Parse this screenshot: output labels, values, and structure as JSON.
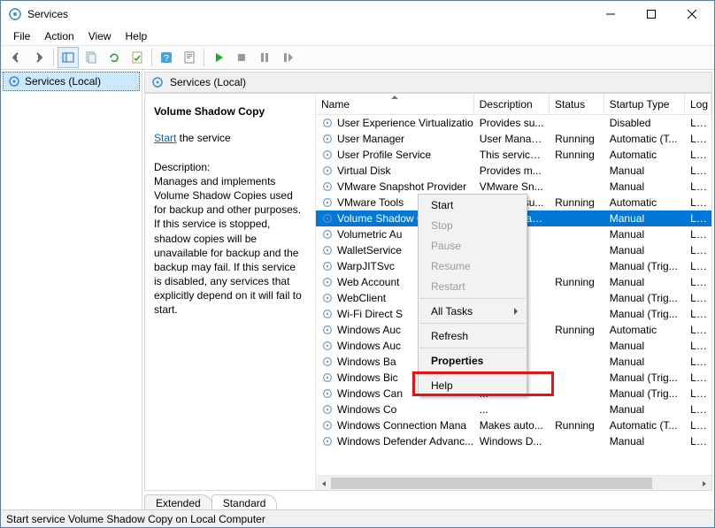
{
  "window": {
    "title": "Services"
  },
  "menu": [
    "File",
    "Action",
    "View",
    "Help"
  ],
  "left": {
    "node": "Services (Local)"
  },
  "pane_header": "Services (Local)",
  "detail": {
    "title": "Volume Shadow Copy",
    "start": "Start",
    "after": " the service",
    "desc_label": "Description:",
    "desc": "Manages and implements Volume Shadow Copies used for backup and other purposes. If this service is stopped, shadow copies will be unavailable for backup and the backup may fail. If this service is disabled, any services that explicitly depend on it will fail to start."
  },
  "columns": [
    "Name",
    "Description",
    "Status",
    "Startup Type",
    "Log"
  ],
  "services": [
    {
      "n": "User Experience Virtualizatio...",
      "d": "Provides su...",
      "s": "",
      "t": "Disabled",
      "l": "Loc"
    },
    {
      "n": "User Manager",
      "d": "User Manag...",
      "s": "Running",
      "t": "Automatic (T...",
      "l": "Loc"
    },
    {
      "n": "User Profile Service",
      "d": "This service ...",
      "s": "Running",
      "t": "Automatic",
      "l": "Loc"
    },
    {
      "n": "Virtual Disk",
      "d": "Provides m...",
      "s": "",
      "t": "Manual",
      "l": "Loc"
    },
    {
      "n": "VMware Snapshot Provider",
      "d": "VMware Sn...",
      "s": "",
      "t": "Manual",
      "l": "Loc"
    },
    {
      "n": "VMware Tools",
      "d": "Provides su...",
      "s": "Running",
      "t": "Automatic",
      "l": "Loc"
    },
    {
      "n": "Volume Shadow Copy",
      "d": "Manages an...",
      "s": "",
      "t": "Manual",
      "l": "Loc",
      "sel": true
    },
    {
      "n": "Volumetric Au",
      "d": "...",
      "s": "",
      "t": "Manual",
      "l": "Loc"
    },
    {
      "n": "WalletService",
      "d": "...",
      "s": "",
      "t": "Manual",
      "l": "Loc"
    },
    {
      "n": "WarpJITSvc",
      "d": "...",
      "s": "",
      "t": "Manual (Trig...",
      "l": "Loc"
    },
    {
      "n": "Web Account",
      "d": "...",
      "s": "Running",
      "t": "Manual",
      "l": "Loc"
    },
    {
      "n": "WebClient",
      "d": "...",
      "s": "",
      "t": "Manual (Trig...",
      "l": "Loc"
    },
    {
      "n": "Wi-Fi Direct S",
      "d": "...",
      "s": "",
      "t": "Manual (Trig...",
      "l": "Loc"
    },
    {
      "n": "Windows Auc",
      "d": "...",
      "s": "Running",
      "t": "Automatic",
      "l": "Loc"
    },
    {
      "n": "Windows Auc",
      "d": "...",
      "s": "",
      "t": "Manual",
      "l": "Loc"
    },
    {
      "n": "Windows Ba",
      "d": "...",
      "s": "",
      "t": "Manual",
      "l": "Loc"
    },
    {
      "n": "Windows Bic",
      "d": "...",
      "s": "",
      "t": "Manual (Trig...",
      "l": "Loc"
    },
    {
      "n": "Windows Can",
      "d": "...",
      "s": "",
      "t": "Manual (Trig...",
      "l": "Loc"
    },
    {
      "n": "Windows Co",
      "d": "...",
      "s": "",
      "t": "Manual",
      "l": "Loc"
    },
    {
      "n": "Windows Connection Mana",
      "d": "Makes auto...",
      "s": "Running",
      "t": "Automatic (T...",
      "l": "Loc"
    },
    {
      "n": "Windows Defender Advanc...",
      "d": "Windows D...",
      "s": "",
      "t": "Manual",
      "l": "Loc"
    }
  ],
  "ctx": {
    "start": "Start",
    "stop": "Stop",
    "pause": "Pause",
    "resume": "Resume",
    "restart": "Restart",
    "alltasks": "All Tasks",
    "refresh": "Refresh",
    "properties": "Properties",
    "help": "Help"
  },
  "tabs": {
    "extended": "Extended",
    "standard": "Standard"
  },
  "status": "Start service Volume Shadow Copy on Local Computer"
}
